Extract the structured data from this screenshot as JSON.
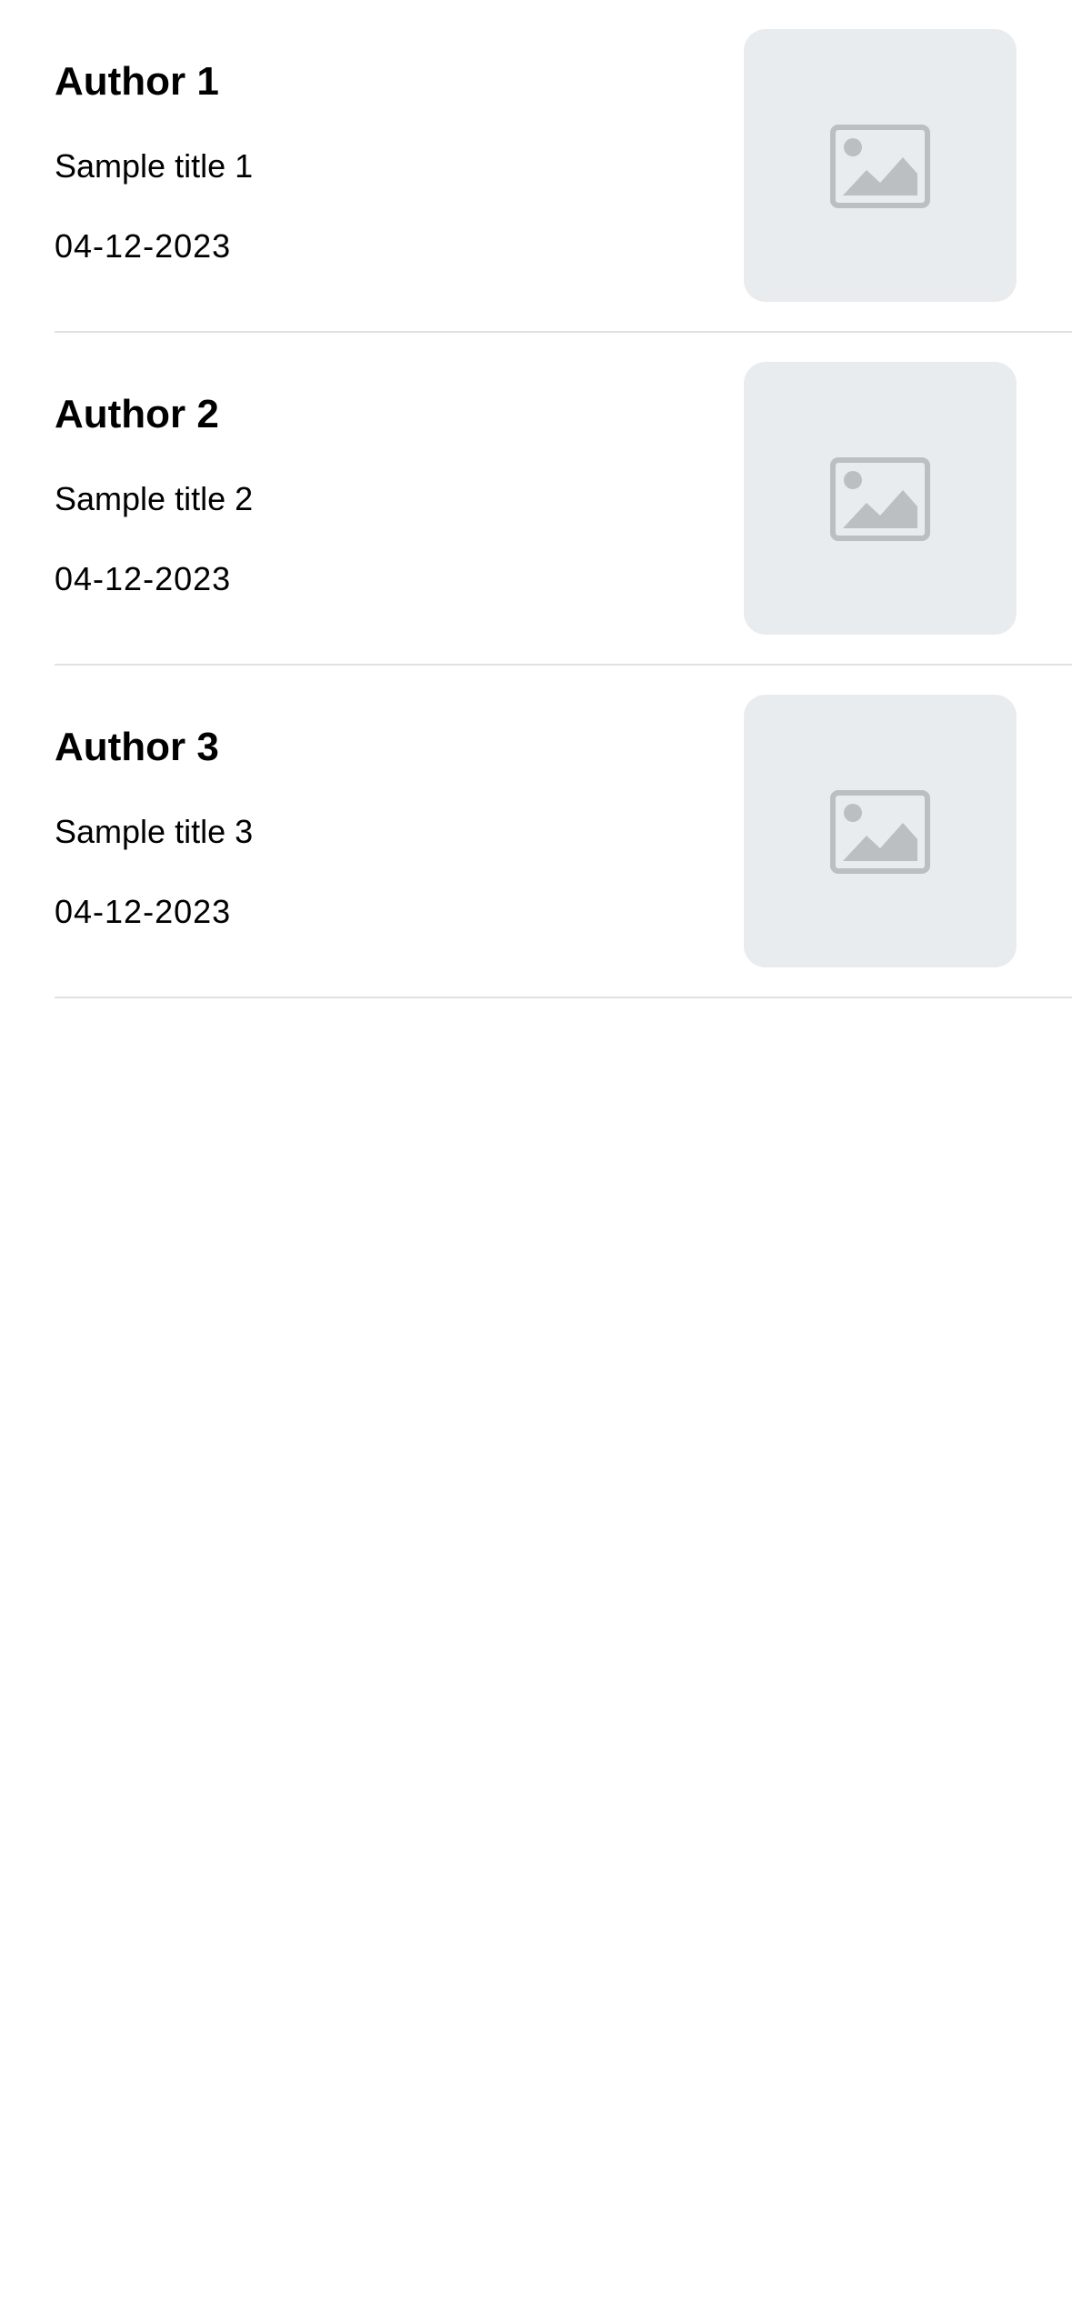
{
  "feed": {
    "items": [
      {
        "author": "Author 1",
        "title": "Sample title 1",
        "date": "04-12-2023",
        "thumbnail_icon": "image-placeholder-icon"
      },
      {
        "author": "Author 2",
        "title": "Sample title 2",
        "date": "04-12-2023",
        "thumbnail_icon": "image-placeholder-icon"
      },
      {
        "author": "Author 3",
        "title": "Sample title 3",
        "date": "04-12-2023",
        "thumbnail_icon": "image-placeholder-icon"
      }
    ]
  },
  "colors": {
    "background": "#ffffff",
    "text": "#000000",
    "thumbnail_background": "#e8ecee",
    "placeholder_icon": "#bcbfc2",
    "divider": "#e1e1e1"
  }
}
